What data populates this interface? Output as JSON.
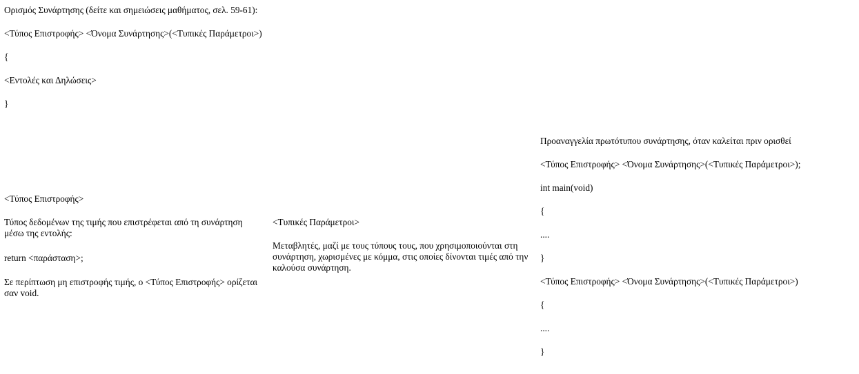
{
  "definition": {
    "title": "Ορισμός Συνάρτησης (δείτε και σημειώσεις μαθήματος, σελ. 59-61):",
    "signature": "<Τύπος Επιστροφής> <Όνομα Συνάρτησης>(<Τυπικές Παράμετροι>)",
    "open_brace": "{",
    "body": "<Εντολές και Δηλώσεις>",
    "close_brace": "}"
  },
  "return_type": {
    "heading": "<Τύπος Επιστροφής>",
    "description": "Τύπος δεδομένων της τιμής που επιστρέφεται από τη συνάρτηση μέσω της εντολής:",
    "return_statement": "return <παράσταση>;",
    "void_note": "Σε περίπτωση μη επιστροφής τιμής, ο <Τύπος Επιστροφής> ορίζεται σαν void."
  },
  "formal_params": {
    "heading": "<Τυπικές Παράμετροι>",
    "description": "Μεταβλητές, μαζί με τους τύπους τους, που χρησιμοποιούνται στη συνάρτηση, χωρισμένες με κόμμα, στις οποίες δίνονται τιμές από την καλούσα συνάρτηση."
  },
  "prototype": {
    "title": "Προαναγγελία πρωτότυπου συνάρτησης, όταν καλείται πριν ορισθεί",
    "declaration": "<Τύπος Επιστροφής> <Όνομα Συνάρτησης>(<Τυπικές Παράμετροι>);",
    "main_signature": "int main(void)",
    "main_open": "{",
    "main_dots": "....",
    "main_close": "}",
    "definition_signature": "<Τύπος Επιστροφής> <Όνομα Συνάρτησης>(<Τυπικές Παράμετροι>)",
    "def_open": "{",
    "def_dots": "....",
    "def_close": "}"
  }
}
